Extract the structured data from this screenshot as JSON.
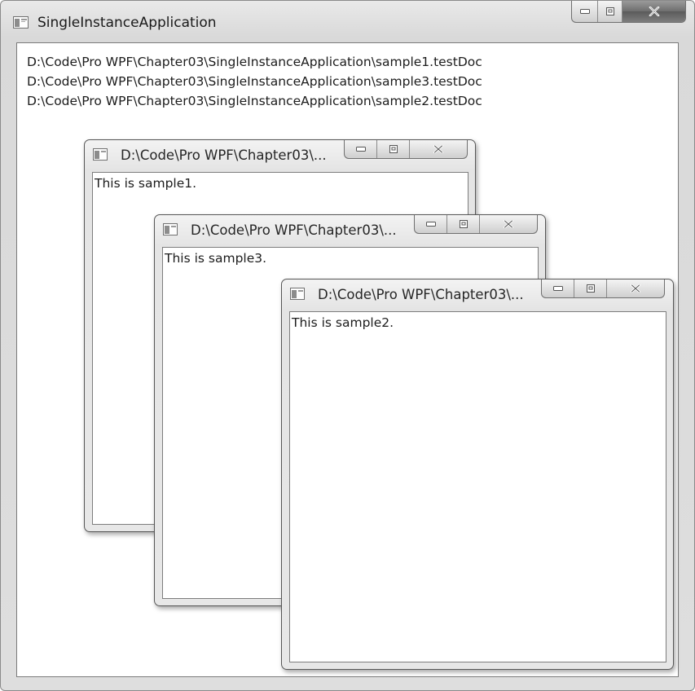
{
  "main_window": {
    "title": "SingleInstanceApplication",
    "paths": [
      "D:\\Code\\Pro WPF\\Chapter03\\SingleInstanceApplication\\sample1.testDoc",
      "D:\\Code\\Pro WPF\\Chapter03\\SingleInstanceApplication\\sample3.testDoc",
      "D:\\Code\\Pro WPF\\Chapter03\\SingleInstanceApplication\\sample2.testDoc"
    ]
  },
  "documents": {
    "sample1": {
      "title": "D:\\Code\\Pro WPF\\Chapter03\\...",
      "content": "This is sample1."
    },
    "sample3": {
      "title": "D:\\Code\\Pro WPF\\Chapter03\\...",
      "content": "This is sample3."
    },
    "sample2": {
      "title": "D:\\Code\\Pro WPF\\Chapter03\\...",
      "content": "This is sample2."
    }
  },
  "icons": {
    "window_icon": "window-icon",
    "minimize": "minimize-icon",
    "maximize": "maximize-icon",
    "close": "close-icon"
  }
}
